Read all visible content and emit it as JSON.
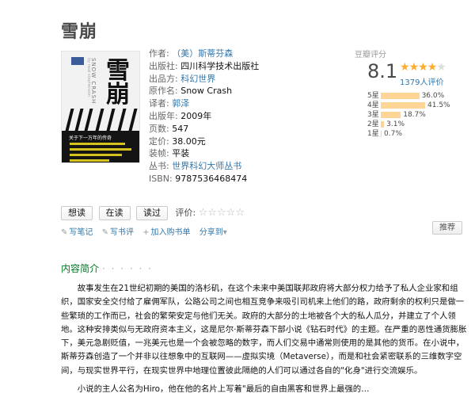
{
  "book": {
    "title": "雪崩",
    "cover": {
      "big_text": "雪崩",
      "en_text": "SNOW CRASH",
      "en_text2": "by neal stephenson",
      "publisher_mark": "科幻",
      "band_text": "关于下一万年的传奇"
    },
    "info": {
      "author_label": "作者:",
      "author_value": "（美）斯蒂芬森",
      "publisher_label": "出版社:",
      "publisher_value": "四川科学技术出版社",
      "producer_label": "出品方:",
      "producer_value": "科幻世界",
      "original_label": "原作名:",
      "original_value": "Snow Crash",
      "translator_label": "译者:",
      "translator_value": "郭泽",
      "year_label": "出版年:",
      "year_value": "2009年",
      "pages_label": "页数:",
      "pages_value": "547",
      "price_label": "定价:",
      "price_value": "38.00元",
      "binding_label": "装帧:",
      "binding_value": "平装",
      "series_label": "丛书:",
      "series_value": "世界科幻大师丛书",
      "isbn_label": "ISBN:",
      "isbn_value": "9787536468474"
    }
  },
  "rating": {
    "title": "豆瓣评分",
    "score": "8.1",
    "stars_filled": 4,
    "votes": "1379人评价",
    "distribution": [
      {
        "label": "5星",
        "percent": "36.0%",
        "value": 36.0
      },
      {
        "label": "4星",
        "percent": "41.5%",
        "value": 41.5
      },
      {
        "label": "3星",
        "percent": "18.7%",
        "value": 18.7
      },
      {
        "label": "2星",
        "percent": "3.1%",
        "value": 3.1
      },
      {
        "label": "1星",
        "percent": "0.7%",
        "value": 0.7
      }
    ]
  },
  "actions": {
    "want": "想读",
    "reading": "在读",
    "read": "读过",
    "rate_label": "评价:",
    "empty_stars": "☆☆☆☆☆"
  },
  "tools": {
    "note": "写笔记",
    "review": "写书评",
    "cart": "加入购书单",
    "share": "分享到",
    "recommend": "推荐"
  },
  "section": {
    "title": "内容简介",
    "dots": "· · · · · ·"
  },
  "intro": {
    "p1": "故事发生在21世纪初期的美国的洛杉矶，在这个未来中美国联邦政府将大部分权力给予了私人企业家和组织，国家安全交付给了雇佣军队，公路公司之间也相互竞争来吸引司机来上他们的路，政府剩余的权利只是做一些繁琐的工作而已，社会的繁荣安定与他们无关。政府的大部分的土地被各个大的私人瓜分，并建立了个人领地。这种安排类似与无政府资本主义，这是尼尔·斯蒂芬森下部小说《钻石时代》的主题。在严重的恶性通货膨胀下，美元急剧贬值，一兆美元也是一个会被忽略的数字，而人们交易中通常则使用的是其他的货币。在小说中，斯蒂芬森创造了一个并非以往想象中的互联网——虚拟实境（Metaverse），而是和社会紧密联系的三维数字空间，与现实世界平行，在现实世界中地理位置彼此隔绝的人们可以通过各自的\"化身\"进行交流娱乐。",
    "p2": "小说的主人公名为Hiro，他在他的名片上写着\"最后的自由黑客和世界上最强的…"
  }
}
